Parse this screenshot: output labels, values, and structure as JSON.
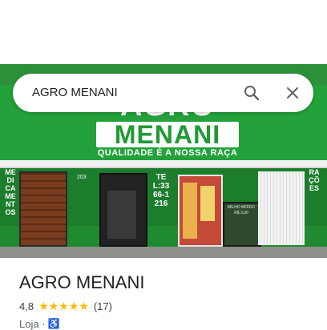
{
  "search": {
    "query": "AGRO MENANI"
  },
  "photo": {
    "sign_top": "AGRO",
    "sign_main": "MENANI",
    "sign_tagline": "QUALIDADE É A NOSSA RAÇA",
    "left_vertical": "MEDICAMENTOS",
    "right_vertical": "RAÇÕES",
    "phone": "TEL:3366-1216",
    "door_number": "203",
    "chalkboard": "MILHO MOÍDO R$ 3,00"
  },
  "place": {
    "name": "AGRO MENANI",
    "rating": "4,8",
    "stars": "★★★★★",
    "review_count": "(17)",
    "category": "Loja ·"
  },
  "colors": {
    "brand_green": "#23a13a",
    "star": "#fbbc04",
    "accessibility_blue": "#1a73e8"
  },
  "icons": [
    "search-icon",
    "close-icon",
    "wheelchair-icon",
    "star-icon"
  ]
}
